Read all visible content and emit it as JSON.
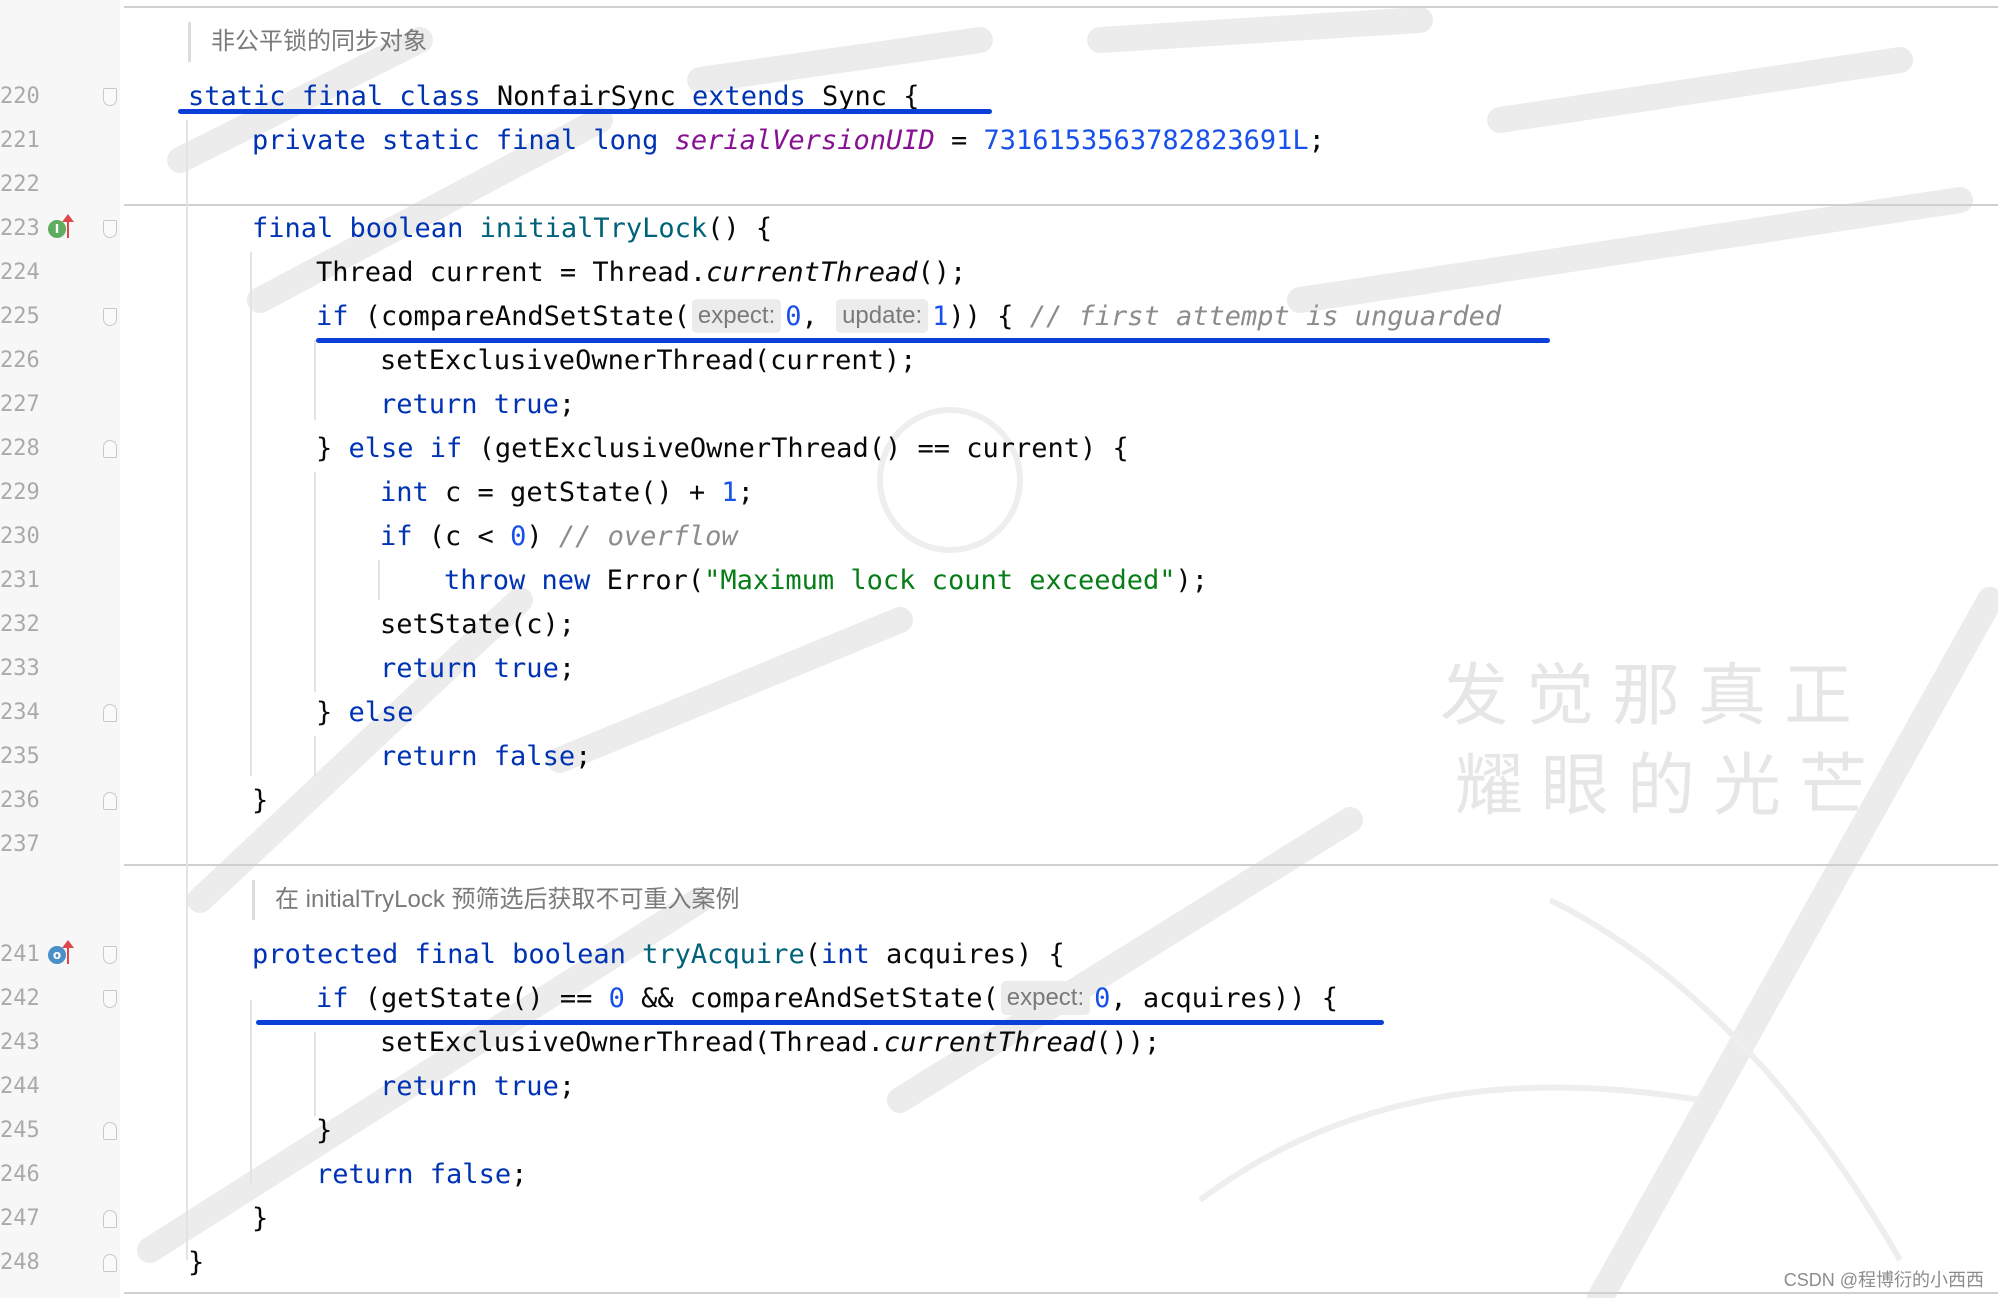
{
  "line_numbers": [
    "220",
    "221",
    "222",
    "223",
    "224",
    "225",
    "226",
    "227",
    "228",
    "229",
    "230",
    "231",
    "232",
    "233",
    "234",
    "235",
    "236",
    "237",
    "241",
    "242",
    "243",
    "244",
    "245",
    "246",
    "247",
    "248"
  ],
  "doc_comments": {
    "nonfair_sync": "非公平锁的同步对象",
    "try_acquire": "在 initialTryLock 预筛选后获取不可重入案例"
  },
  "code": {
    "l220": {
      "static": "static",
      "final": "final",
      "class": "class",
      "name": " NonfairSync ",
      "extends": "extends",
      "rest": " Sync {"
    },
    "l221": {
      "mods": "private static final long ",
      "field": "serialVersionUID",
      "eq": " = ",
      "num": "7316153563782823691L",
      "end": ";"
    },
    "l223": {
      "mods": "final boolean ",
      "fn": "initialTryLock",
      "rest": "() {"
    },
    "l224": {
      "pre": "Thread current = Thread.",
      "it": "currentThread",
      "rest": "();"
    },
    "l225": {
      "kw": "if",
      "call": " (compareAndSetState(",
      "hint1": "expect:",
      "n1": "0",
      "sep": ", ",
      "hint2": "update:",
      "n2": "1",
      "rest": ")) { ",
      "cmt": "// first attempt is unguarded"
    },
    "l226": {
      "text": "setExclusiveOwnerThread(current);"
    },
    "l227": {
      "kw": "return ",
      "val": "true",
      "end": ";"
    },
    "l228": {
      "pre": "} ",
      "kw": "else if",
      "rest": " (getExclusiveOwnerThread() == current) {"
    },
    "l229": {
      "kw": "int",
      "mid": " c = getState() + ",
      "num": "1",
      "end": ";"
    },
    "l230": {
      "kw": "if",
      "mid": " (c < ",
      "num": "0",
      "rest": ") ",
      "cmt": "// overflow"
    },
    "l231": {
      "kw": "throw new",
      "mid": " Error(",
      "str": "\"Maximum lock count exceeded\"",
      "end": ");"
    },
    "l232": {
      "text": "setState(c);"
    },
    "l233": {
      "kw": "return ",
      "val": "true",
      "end": ";"
    },
    "l234": {
      "pre": "} ",
      "kw": "else"
    },
    "l235": {
      "kw": "return ",
      "val": "false",
      "end": ";"
    },
    "l236": {
      "text": "}"
    },
    "l241": {
      "mods": "protected final boolean ",
      "fn": "tryAcquire",
      "open": "(",
      "kw": "int",
      "rest": " acquires) {"
    },
    "l242": {
      "kw": "if",
      "mid": " (getState() == ",
      "num": "0",
      "mid2": " && compareAndSetState(",
      "hint": "expect:",
      "n2": "0",
      "rest": ", acquires)) {"
    },
    "l243": {
      "pre": "setExclusiveOwnerThread(Thread.",
      "it": "currentThread",
      "rest": "());"
    },
    "l244": {
      "kw": "return ",
      "val": "true",
      "end": ";"
    },
    "l245": {
      "text": "}"
    },
    "l246": {
      "kw": "return ",
      "val": "false",
      "end": ";"
    },
    "l247": {
      "text": "}"
    },
    "l248": {
      "text": "}"
    }
  },
  "watermark": {
    "line1": "发觉那真正",
    "line2": "耀眼的光芒"
  },
  "credit": "CSDN @程博衍的小西西",
  "colors": {
    "keyword": "#0033b3",
    "function": "#00627a",
    "number": "#1750eb",
    "string": "#067d17",
    "comment": "#8c8c8c",
    "annotation_underline": "#0a3fd8"
  }
}
